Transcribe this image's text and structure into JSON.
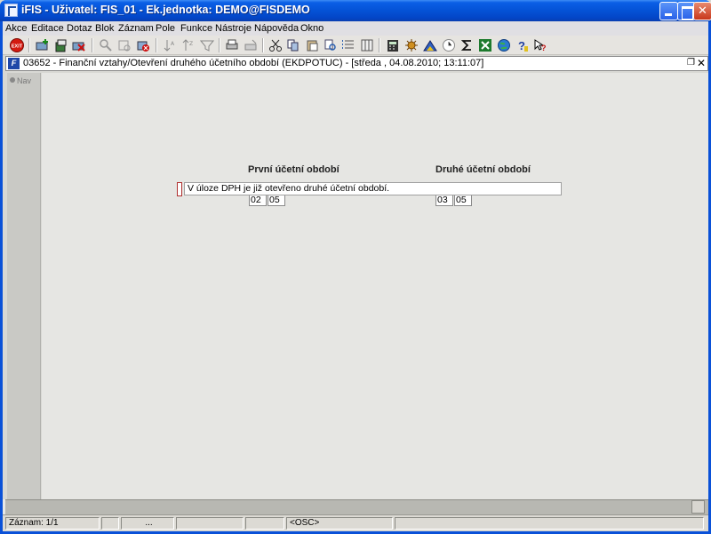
{
  "window": {
    "title": "iFIS - Uživatel: FIS_01 - Ek.jednotka: DEMO@FISDEMO",
    "controls": {
      "minimize": "",
      "maximize": "",
      "close": ""
    }
  },
  "menubar": [
    "Akce",
    "Editace",
    "Dotaz",
    "Blok",
    "Záznam",
    "Pole",
    "Funkce",
    "Nástroje",
    "Nápověda",
    "Okno"
  ],
  "toolbar": {
    "icons": [
      "exit-icon",
      "insert-record-icon",
      "save-icon",
      "delete-record-icon",
      "query-icon",
      "execute-query-icon",
      "cancel-query-icon",
      "sort-asc-icon",
      "sort-desc-icon",
      "filter-icon",
      "print-icon",
      "print-setup-icon",
      "cut-icon",
      "copy-icon",
      "paste-icon",
      "find-icon",
      "list-icon",
      "columns-icon",
      "calculator-icon",
      "settings-icon",
      "chart-icon",
      "clock-icon",
      "sum-icon",
      "excel-icon",
      "globe-icon",
      "help-icon",
      "context-help-icon"
    ],
    "exit_label": "EXIT"
  },
  "form_window": {
    "title": "03652 - Finanční vztahy/Otevření druhého účetního období (EKDPOTUC) - [středa , 04.08.2010; 13:11:07]",
    "nav_label": "Nav"
  },
  "form": {
    "first_period": {
      "label": "První účetní období",
      "month": "02",
      "year": "05"
    },
    "second_period": {
      "label": "Druhé účetní období",
      "month": "03",
      "year": "05"
    },
    "message": "V úloze DPH je již otevřeno druhé účetní období."
  },
  "status": {
    "record": "Záznam: 1/1",
    "cell2": "",
    "cell3": "...",
    "cell4": "",
    "cell5": "",
    "mode": "<OSC>",
    "cell7": ""
  },
  "colors": {
    "title_bar": "#0452d6",
    "client_bg": "#e6e6e3",
    "nav_bg": "#c9c9c5"
  }
}
